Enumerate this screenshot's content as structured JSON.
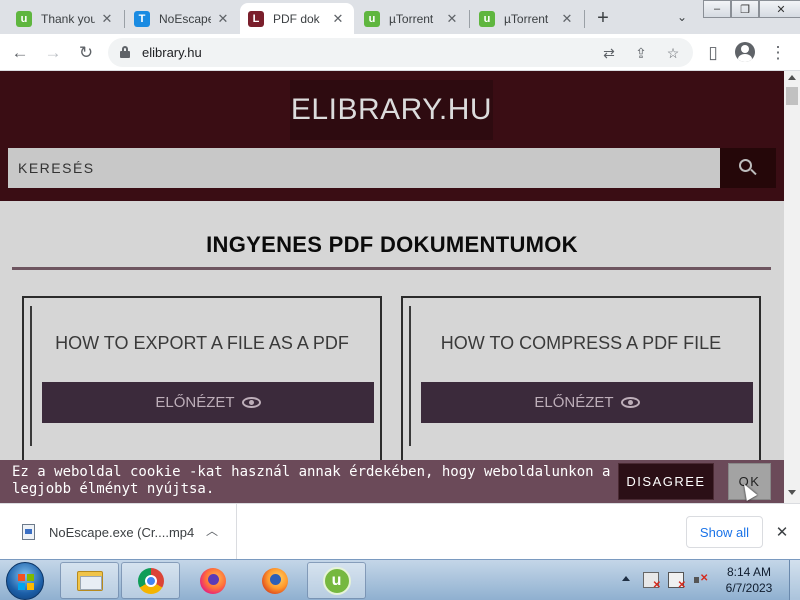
{
  "browser": {
    "tabs": [
      {
        "label": "Thank you",
        "favicon": "utorrent-icon",
        "active": false
      },
      {
        "label": "NoEscape",
        "favicon": "t-icon",
        "active": false
      },
      {
        "label": "PDF dok",
        "favicon": "l-icon",
        "active": true
      },
      {
        "label": "µTorrent",
        "favicon": "utorrent-icon",
        "active": false
      },
      {
        "label": "µTorrent",
        "favicon": "utorrent-icon",
        "active": false
      }
    ],
    "favicon_letters": {
      "t": "T",
      "l": "L",
      "u": "u"
    },
    "new_tab_glyph": "+",
    "url": "elibrary.hu"
  },
  "page": {
    "logo": "ELIBRARY.HU",
    "search_placeholder": "KERESÉS",
    "heading": "INGYENES PDF DOKUMENTUMOK",
    "cards": [
      {
        "title": "HOW TO EXPORT A FILE AS A PDF",
        "button": "ELŐNÉZET"
      },
      {
        "title": "HOW TO COMPRESS A PDF FILE",
        "button": "ELŐNÉZET"
      }
    ],
    "colors": {
      "header": "#3a0d14",
      "card_button": "#3b2a3b",
      "cookie_bar": "#6b4a59"
    }
  },
  "cookie": {
    "message": "Ez a weboldal cookie -kat használ annak érdekében, hogy weboldalunkon a legjobb élményt nyújtsa.",
    "disagree": "DISAGREE",
    "ok": "OK"
  },
  "downloads": {
    "file": "NoEscape.exe (Cr....mp4",
    "show_all": "Show all"
  },
  "taskbar": {
    "apps": [
      "folder-icon",
      "chrome-icon",
      "firefox-icon",
      "firefox-icon",
      "utorrent-icon"
    ],
    "time": "8:14 AM",
    "date": "6/7/2023"
  }
}
